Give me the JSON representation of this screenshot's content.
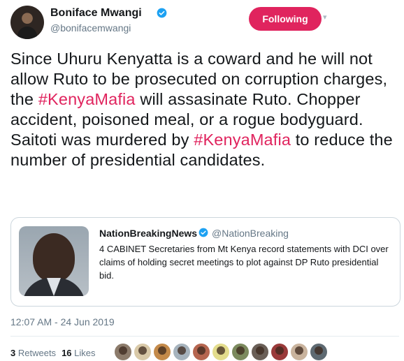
{
  "tweet": {
    "display_name": "Boniface Mwangi",
    "handle": "@bonifacemwangi",
    "follow_label": "Following",
    "text_parts": {
      "p1": "Since Uhuru Kenyatta is a coward and he will not allow Ruto to be prosecuted on corruption charges, the ",
      "tag1": "#KenyaMafia",
      "p2": " will assasinate Ruto. Chopper accident, poisoned meal, or a rogue bodyguard. Saitoti was murdered by ",
      "tag2": "#KenyaMafia",
      "p3": " to reduce the number of presidential candidates."
    },
    "timestamp": "12:07 AM - 24 Jun 2019"
  },
  "quoted_tweet": {
    "display_name": "NationBreakingNews",
    "handle": "@NationBreaking",
    "text": "4 CABINET Secretaries from Mt Kenya record statements with DCI over claims of holding secret meetings to plot against DP Ruto presidential bid."
  },
  "stats": {
    "retweets_count": "3",
    "retweets_label": "Retweets",
    "likes_count": "16",
    "likes_label": "Likes"
  },
  "colors": {
    "accent": "#e0245e",
    "verified": "#1da1f2",
    "muted": "#657786",
    "liker_avatars": [
      "#8c7b6b",
      "#d9c9a8",
      "#c48a4a",
      "#a6b3bd",
      "#b5654f",
      "#e3dc8c",
      "#7c8a5e",
      "#6a5f57",
      "#9a3a3a",
      "#c9b39d",
      "#5e6a72"
    ]
  },
  "icons": {
    "verified": "verified-badge-icon",
    "caret": "chevron-down-icon"
  }
}
